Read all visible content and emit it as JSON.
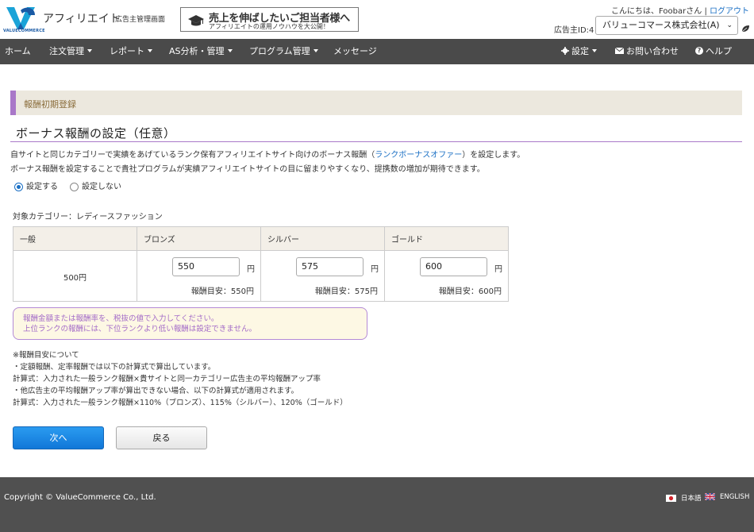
{
  "header": {
    "logo_sub": "VALUECOMMERCE",
    "brand": "アフィリエイト",
    "brand_sub": "広告主管理画面",
    "banner_title": "売上を伸ばしたいご担当者様へ",
    "banner_sub": "アフィリエイトの運用ノウハウを大公開！",
    "greeting": "こんにちは、Foobarさん",
    "separator": "|",
    "logout": "ログアウト",
    "advertiser_id_label": "広告主ID:4",
    "advertiser_name": "バリューコマース株式会社(A)"
  },
  "nav": {
    "home": "ホーム",
    "orders": "注文管理",
    "reports": "レポート",
    "as_analysis": "AS分析・管理",
    "programs": "プログラム管理",
    "messages": "メッセージ",
    "settings": "設定",
    "contact": "お問い合わせ",
    "help": "ヘルプ"
  },
  "section": {
    "header": "報酬初期登録",
    "title": "ボーナス報酬の設定（任意）",
    "desc1_pre": "自サイトと同じカテゴリーで実績をあげているランク保有アフィリエイトサイト向けのボーナス報酬（",
    "desc1_link": "ランクボーナスオファー",
    "desc1_post": "）を設定します。",
    "desc2": "ボーナス報酬を設定することで貴社プログラムが実績アフィリエイトサイトの目に留まりやすくなり、提携数の増加が期待できます。",
    "radio_on": "設定する",
    "radio_off": "設定しない",
    "category": "対象カテゴリー：レディースファッション"
  },
  "table": {
    "headers": [
      "一般",
      "ブロンズ",
      "シルバー",
      "ゴールド"
    ],
    "base_value": "500円",
    "unit": "円",
    "bronze_value": "550",
    "silver_value": "575",
    "gold_value": "600",
    "bronze_est": "報酬目安：550円",
    "silver_est": "報酬目安：575円",
    "gold_est": "報酬目安：600円"
  },
  "notice": {
    "line1": "報酬金額または報酬率を、税抜の値で入力してください。",
    "line2": "上位ランクの報酬には、下位ランクより低い報酬は設定できません。"
  },
  "notes": [
    "※報酬目安について",
    "・定額報酬、定率報酬では以下の計算式で算出しています。",
    "計算式：入力された一般ランク報酬×貴サイトと同一カテゴリー広告主の平均報酬アップ率",
    "・他広告主の平均報酬アップ率が算出できない場合、以下の計算式が適用されます。",
    "計算式：入力された一般ランク報酬×110%（ブロンズ）、115%（シルバー）、120%（ゴールド）"
  ],
  "buttons": {
    "next": "次へ",
    "back": "戻る"
  },
  "footer": {
    "copyright": "Copyright © ValueCommerce Co., Ltd.",
    "lang_ja": "日本語",
    "lang_en": "ENGLISH"
  },
  "colors": {
    "nav_bg": "#4a4a4a",
    "accent_purple": "#a978c8",
    "link_blue": "#1a6fc4",
    "primary_button": "#1a88e6",
    "footer_bg": "#505050"
  }
}
